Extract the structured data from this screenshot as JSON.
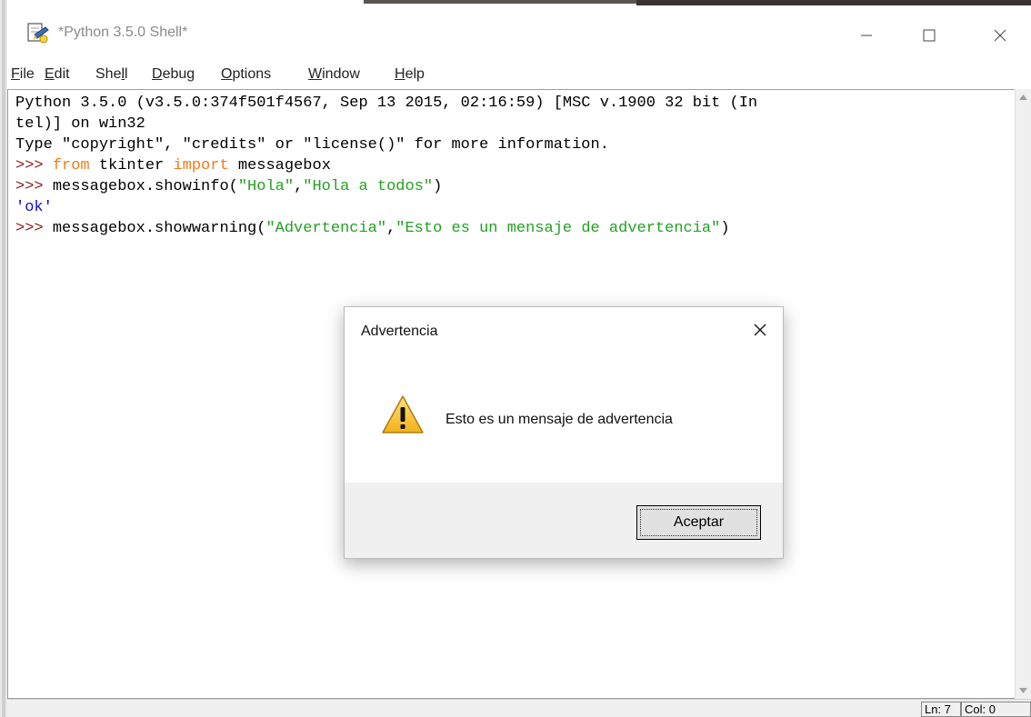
{
  "window": {
    "title": "*Python 3.5.0 Shell*",
    "icon": "idle-python-icon",
    "controls": {
      "minimize": "minimize-icon",
      "maximize": "maximize-icon",
      "close": "close-icon"
    }
  },
  "menu": {
    "file": {
      "key": "F",
      "rest": "ile"
    },
    "edit": {
      "key": "E",
      "rest": "dit"
    },
    "shell": {
      "pre": "She",
      "key": "l",
      "rest": "l"
    },
    "debug": {
      "key": "D",
      "rest": "ebug"
    },
    "options": {
      "key": "O",
      "rest": "ptions"
    },
    "window": {
      "key": "W",
      "rest": "indow"
    },
    "help": {
      "key": "H",
      "rest": "elp"
    }
  },
  "shell": {
    "banner_1": "Python 3.5.0 (v3.5.0:374f501f4567, Sep 13 2015, 02:16:59) [MSC v.1900 32 bit (In",
    "banner_2": "tel)] on win32",
    "banner_3": "Type \"copyright\", \"credits\" or \"license()\" for more information.",
    "prompt": ">>> ",
    "l4_kw1": "from",
    "l4_mid": " tkinter ",
    "l4_kw2": "import",
    "l4_end": " messagebox",
    "l5_code": "messagebox.showinfo(",
    "l5_str1": "\"Hola\"",
    "l5_comma": ",",
    "l5_str2": "\"Hola a todos\"",
    "l5_close": ")",
    "l6_output": "'ok'",
    "l7_code": "messagebox.showwarning(",
    "l7_str1": "\"Advertencia\"",
    "l7_comma": ",",
    "l7_str2": "\"Esto es un mensaje de advertencia\"",
    "l7_close": ")"
  },
  "status": {
    "line": "Ln: 7",
    "column": "Col: 0"
  },
  "dialog": {
    "title": "Advertencia",
    "message": "Esto es un mensaje de advertencia",
    "button": "Aceptar",
    "icon": "warning-icon",
    "close_icon": "close-icon"
  },
  "colors": {
    "prompt": "#8b1a1a",
    "keyword": "#ef7d17",
    "string": "#22a022",
    "output": "#1010c8",
    "warning_fill": "#f7c42f"
  }
}
